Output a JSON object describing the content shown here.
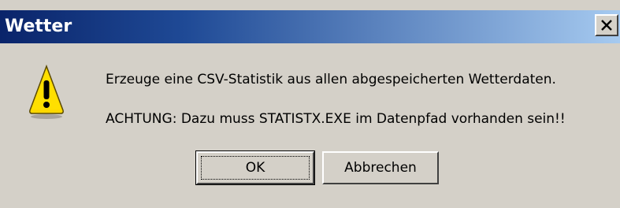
{
  "window": {
    "title": "Wetter",
    "close_icon": "close-icon"
  },
  "message": {
    "icon": "warning-icon",
    "line1": "Erzeuge eine CSV-Statistik aus allen abgespeicherten Wetterdaten.",
    "line2": "ACHTUNG: Dazu muss STATISTX.EXE im Datenpfad vorhanden sein!!"
  },
  "buttons": {
    "ok_label": "OK",
    "cancel_label": "Abbrechen"
  },
  "colors": {
    "titlebar_start": "#0a246a",
    "titlebar_end": "#a6caf0",
    "dialog_bg": "#d4d0c8",
    "warning_fill": "#ffd800"
  }
}
